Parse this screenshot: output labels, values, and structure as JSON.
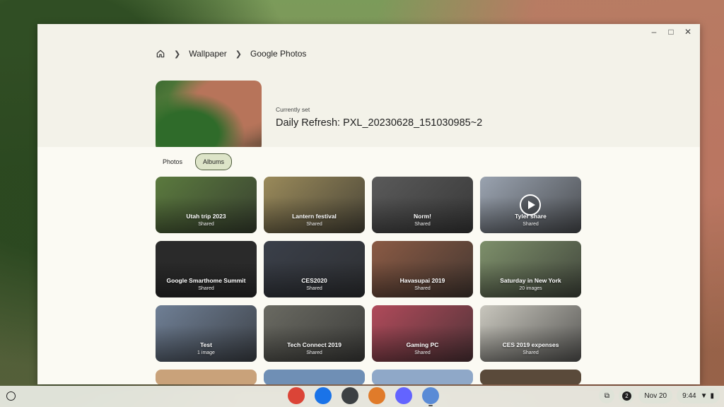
{
  "window": {
    "minimize_icon": "minimize-icon",
    "maximize_icon": "maximize-icon",
    "close_icon": "close-icon"
  },
  "breadcrumb": {
    "home_icon": "home-icon",
    "items": [
      "Wallpaper",
      "Google Photos"
    ]
  },
  "current": {
    "label": "Currently set",
    "title": "Daily Refresh: PXL_20230628_151030985~2"
  },
  "tabs": [
    {
      "label": "Photos",
      "active": false
    },
    {
      "label": "Albums",
      "active": true
    }
  ],
  "albums": [
    {
      "name": "Utah trip 2023",
      "sub": "Shared",
      "color": "#5b7a3e"
    },
    {
      "name": "Lantern festival",
      "sub": "Shared",
      "color": "#9a8a5a"
    },
    {
      "name": "Norm!",
      "sub": "Shared",
      "color": "#5a5a5a"
    },
    {
      "name": "Tyler share",
      "sub": "Shared",
      "color": "#9aa3b0",
      "video": true
    },
    {
      "name": "Google Smarthome Summit",
      "sub": "Shared",
      "color": "#2a2a2a"
    },
    {
      "name": "CES2020",
      "sub": "Shared",
      "color": "#3a3f49"
    },
    {
      "name": "Havasupai 2019",
      "sub": "Shared",
      "color": "#8a5a44"
    },
    {
      "name": "Saturday in New York",
      "sub": "20 images",
      "color": "#7d8f6a"
    },
    {
      "name": "Test",
      "sub": "1 image",
      "color": "#6f7f95"
    },
    {
      "name": "Tech Connect 2019",
      "sub": "Shared",
      "color": "#6a6a62"
    },
    {
      "name": "Gaming PC",
      "sub": "Shared",
      "color": "#b04a5a"
    },
    {
      "name": "CES 2019 expenses",
      "sub": "Shared",
      "color": "#c8c6bd"
    }
  ],
  "partial_row_colors": [
    "#c9a27a",
    "#6f8fb5",
    "#8fa8c8",
    "#5a4a3a"
  ],
  "shelf": {
    "launcher_icon": "launcher-icon",
    "apps": [
      {
        "name": "chrome-icon",
        "color": "#db4437",
        "active": false
      },
      {
        "name": "files-icon",
        "color": "#1a73e8",
        "active": false
      },
      {
        "name": "terminal-icon",
        "color": "#3c4043",
        "active": false
      },
      {
        "name": "app-icon",
        "color": "#e07b2a",
        "active": false
      },
      {
        "name": "mastodon-icon",
        "color": "#6364ff",
        "active": false
      },
      {
        "name": "wallpaper-icon",
        "color": "#5a8bd6",
        "active": true
      }
    ],
    "notification_count": "2",
    "date": "Nov 20",
    "time": "9:44"
  }
}
